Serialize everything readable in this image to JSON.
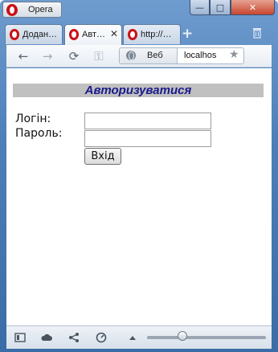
{
  "titlebar": {
    "app_button": "Opera",
    "controls": {
      "minimize": "—",
      "maximize": "□",
      "close": "✕"
    }
  },
  "tabs": [
    {
      "label": "Додан…",
      "active": false
    },
    {
      "label": "Авт…",
      "active": true,
      "close": "✕"
    },
    {
      "label": "http://…",
      "active": false
    }
  ],
  "tabstrip": {
    "new_tab": "+"
  },
  "toolbar": {
    "back": "←",
    "forward": "→",
    "reload": "⟳",
    "key": "⚿",
    "address": {
      "scope_label": "Веб",
      "url": "localhos",
      "star": "★"
    }
  },
  "page": {
    "heading": "Авторизуватися",
    "login_label": "Логін:",
    "password_label": "Пароль:",
    "login_value": "",
    "password_value": "",
    "submit_label": "Вхід"
  },
  "statusbar": {
    "icons": [
      "panel-icon",
      "cloud-icon",
      "share-icon",
      "speed-dial-icon",
      "triangle-icon"
    ],
    "zoom_slider_fraction": 0.3
  }
}
